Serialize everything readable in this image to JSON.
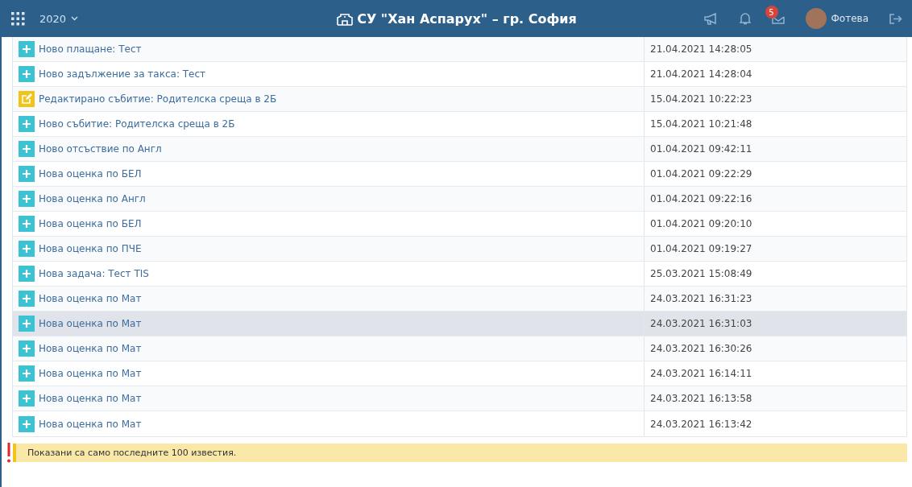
{
  "header": {
    "year": "2020",
    "title": "СУ \"Хан Аспарух\" – гр. София",
    "message_count": "5",
    "user_name": "Фотева"
  },
  "notifications": [
    {
      "kind": "added",
      "text": "Ново плащане: Тест",
      "time": "21.04.2021 14:28:05",
      "selected": false
    },
    {
      "kind": "added",
      "text": "Ново задължение за такса: Тест",
      "time": "21.04.2021 14:28:04",
      "selected": false
    },
    {
      "kind": "edited",
      "text": "Редактирано събитие: Родителска среща в 2Б",
      "time": "15.04.2021 10:22:23",
      "selected": false
    },
    {
      "kind": "added",
      "text": "Ново събитие: Родителска среща в 2Б",
      "time": "15.04.2021 10:21:48",
      "selected": false
    },
    {
      "kind": "added",
      "text": "Ново отсъствие по Англ",
      "time": "01.04.2021 09:42:11",
      "selected": false
    },
    {
      "kind": "added",
      "text": "Нова оценка по БЕЛ",
      "time": "01.04.2021 09:22:29",
      "selected": false
    },
    {
      "kind": "added",
      "text": "Нова оценка по Англ",
      "time": "01.04.2021 09:22:16",
      "selected": false
    },
    {
      "kind": "added",
      "text": "Нова оценка по БЕЛ",
      "time": "01.04.2021 09:20:10",
      "selected": false
    },
    {
      "kind": "added",
      "text": "Нова оценка по ПЧЕ",
      "time": "01.04.2021 09:19:27",
      "selected": false
    },
    {
      "kind": "added",
      "text": "Нова задача: Тест TIS",
      "time": "25.03.2021 15:08:49",
      "selected": false
    },
    {
      "kind": "added",
      "text": "Нова оценка по Мат",
      "time": "24.03.2021 16:31:23",
      "selected": false
    },
    {
      "kind": "added",
      "text": "Нова оценка по Мат",
      "time": "24.03.2021 16:31:03",
      "selected": true
    },
    {
      "kind": "added",
      "text": "Нова оценка по Мат",
      "time": "24.03.2021 16:30:26",
      "selected": false
    },
    {
      "kind": "added",
      "text": "Нова оценка по Мат",
      "time": "24.03.2021 16:14:11",
      "selected": false
    },
    {
      "kind": "added",
      "text": "Нова оценка по Мат",
      "time": "24.03.2021 16:13:58",
      "selected": false
    },
    {
      "kind": "added",
      "text": "Нова оценка по Мат",
      "time": "24.03.2021 16:13:42",
      "selected": false
    }
  ],
  "notice": "Показани са само последните 100 известия."
}
